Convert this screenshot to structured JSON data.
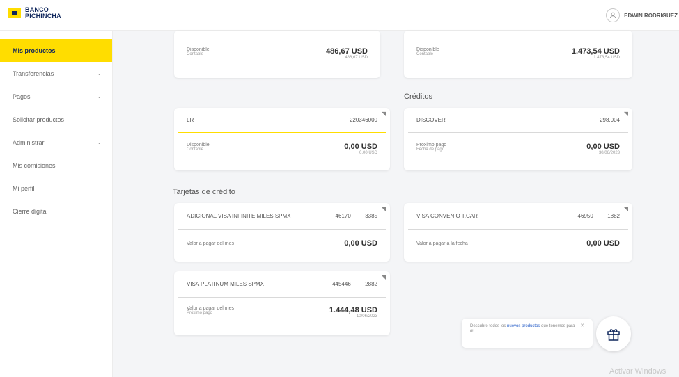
{
  "brand": {
    "line1": "BANCO",
    "line2": "PICHINCHA",
    "yellow": "#ffdd00",
    "navy": "#0f265c"
  },
  "header": {
    "user_name": "EDWIN RODRIGUEZ",
    "user_icon": "user-avatar-icon"
  },
  "sidebar": {
    "items": [
      {
        "label": "Mis productos",
        "active": true,
        "has_chevron": false
      },
      {
        "label": "Transferencias",
        "active": false,
        "has_chevron": true
      },
      {
        "label": "Pagos",
        "active": false,
        "has_chevron": true
      },
      {
        "label": "Solicitar productos",
        "active": false,
        "has_chevron": false
      },
      {
        "label": "Administrar",
        "active": false,
        "has_chevron": true
      },
      {
        "label": "Mis comisiones",
        "active": false,
        "has_chevron": false
      },
      {
        "label": "Mi perfil",
        "active": false,
        "has_chevron": false
      },
      {
        "label": "Cierre digital",
        "active": false,
        "has_chevron": false
      }
    ]
  },
  "accounts": [
    {
      "label_main": "Disponible",
      "label_sub": "Contable",
      "amount": "486,67 USD",
      "sub_amount": "486,67 USD"
    },
    {
      "label_main": "Disponible",
      "label_sub": "Contable",
      "amount": "1.473,54 USD",
      "sub_amount": "1.473,54 USD"
    }
  ],
  "credits_title": "Créditos",
  "credits": [
    {
      "name": "LR",
      "number": "220346000",
      "label_main": "Disponible",
      "label_sub": "Contable",
      "amount": "0,00 USD",
      "sub_amount": "0,00 USD"
    },
    {
      "name": "DISCOVER",
      "number": "298,004",
      "label_main": "Próximo pago",
      "label_sub": "Fecha de pago",
      "amount": "0,00 USD",
      "sub_amount": "30/06/2023"
    }
  ],
  "cards_title": "Tarjetas de crédito",
  "cards": [
    {
      "name": "ADICIONAL VISA INFINITE MILES SPMX",
      "number": "46170 ······ 3385",
      "label_main": "Valor a pagar del mes",
      "amount": "0,00 USD"
    },
    {
      "name": "VISA CONVENIO T.CAR",
      "number": "46950 ······ 1882",
      "label_main": "Valor a pagar a la fecha",
      "amount": "0,00 USD"
    },
    {
      "name": "VISA PLATINUM MILES SPMX",
      "number": "445446 ······ 2882",
      "label_main": "Valor a pagar del mes",
      "label_sub": "Próximo pago",
      "amount": "1.444,48 USD",
      "sub_amount": "10/06/2023"
    }
  ],
  "promo": {
    "text_before": "Descubre todos los",
    "link1": "nuevos",
    "link2": "productos",
    "text_after": "que tenemos para ti!"
  },
  "watermark": "Activar Windows"
}
